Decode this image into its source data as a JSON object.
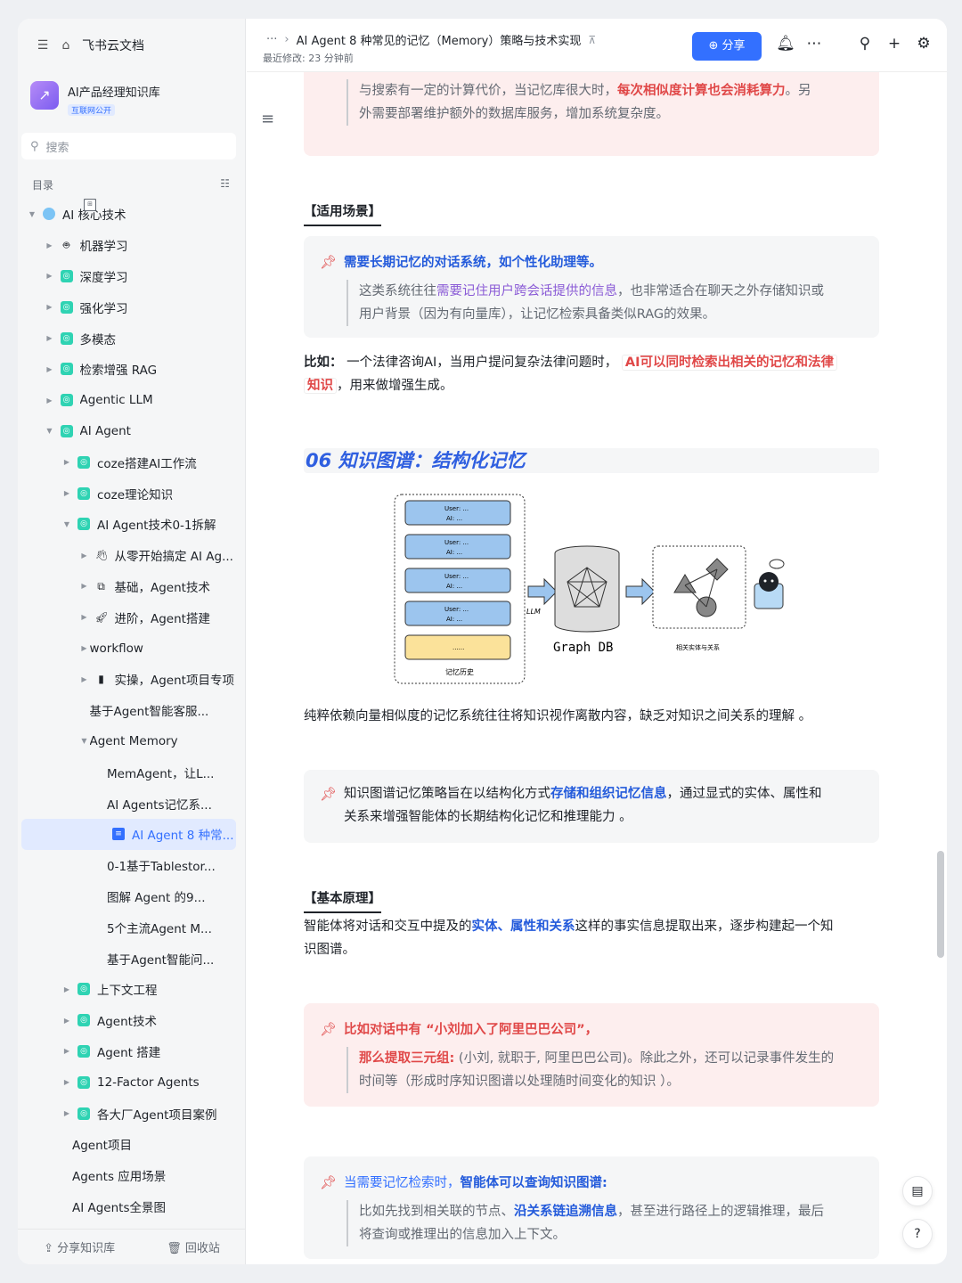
{
  "sidebar": {
    "app_name": "飞书云文档",
    "kb_name": "AI产品经理知识库",
    "kb_tag": "互联网公开",
    "search_placeholder": "搜索",
    "toc_label": "目录",
    "items": [
      {
        "label": "AI 核心技术",
        "level": 0,
        "icon": "globe-icon",
        "arrow": "down"
      },
      {
        "label": "机器学习",
        "level": 1,
        "icon": "robot-emoji-icon",
        "arrow": "right"
      },
      {
        "label": "深度学习",
        "level": 1,
        "icon": "teal-doc-icon",
        "arrow": "right"
      },
      {
        "label": "强化学习",
        "level": 1,
        "icon": "teal-doc-icon",
        "arrow": "right"
      },
      {
        "label": "多模态",
        "level": 1,
        "icon": "teal-doc-icon",
        "arrow": "right"
      },
      {
        "label": "检索增强 RAG",
        "level": 1,
        "icon": "teal-doc-icon",
        "arrow": "right"
      },
      {
        "label": "Agentic LLM",
        "level": 1,
        "icon": "teal-doc-icon",
        "arrow": "right"
      },
      {
        "label": "AI Agent",
        "level": 1,
        "icon": "teal-doc-icon",
        "arrow": "down"
      },
      {
        "label": "coze搭建AI工作流",
        "level": 2,
        "icon": "teal-doc-icon",
        "arrow": "right"
      },
      {
        "label": "coze理论知识",
        "level": 2,
        "icon": "teal-doc-icon",
        "arrow": "right"
      },
      {
        "label": "AI Agent技术0-1拆解",
        "level": 2,
        "icon": "teal-doc-icon",
        "arrow": "down"
      },
      {
        "label": "从零开始搞定 AI Ag...",
        "level": 3,
        "icon": "hand-emoji-icon",
        "arrow": "right"
      },
      {
        "label": "基础，Agent技术",
        "level": 3,
        "icon": "blocks-emoji-icon",
        "arrow": "right"
      },
      {
        "label": "进阶，Agent搭建",
        "level": 3,
        "icon": "rocket-emoji-icon",
        "arrow": "right"
      },
      {
        "label": "workflow",
        "level": 3,
        "icon": "doc-icon",
        "arrow": "right"
      },
      {
        "label": "实操，Agent项目专项",
        "level": 3,
        "icon": "note-emoji-icon",
        "arrow": "right"
      },
      {
        "label": "基于Agent智能客服...",
        "level": 3,
        "icon": "doc-icon",
        "arrow": ""
      },
      {
        "label": "Agent Memory",
        "level": 3,
        "icon": "doc-icon",
        "arrow": "down"
      },
      {
        "label": "MemAgent，让L...",
        "level": 4,
        "icon": "page-icon",
        "arrow": ""
      },
      {
        "label": "AI Agents记忆系...",
        "level": 4,
        "icon": "doc-icon",
        "arrow": ""
      },
      {
        "label": "AI Agent 8 种常...",
        "level": 4,
        "icon": "doc-blue-icon",
        "arrow": "",
        "active": true
      },
      {
        "label": "0-1基于Tablestor...",
        "level": 4,
        "icon": "doc-icon",
        "arrow": ""
      },
      {
        "label": "图解 Agent 的9...",
        "level": 4,
        "icon": "doc-icon",
        "arrow": ""
      },
      {
        "label": "5个主流Agent M...",
        "level": 4,
        "icon": "doc-icon",
        "arrow": ""
      },
      {
        "label": "基于Agent智能问...",
        "level": 4,
        "icon": "doc-icon",
        "arrow": ""
      },
      {
        "label": "上下文工程",
        "level": 2,
        "icon": "teal-doc-icon",
        "arrow": "right"
      },
      {
        "label": "Agent技术",
        "level": 2,
        "icon": "teal-doc-icon",
        "arrow": "right"
      },
      {
        "label": "Agent 搭建",
        "level": 2,
        "icon": "teal-doc-icon",
        "arrow": "right"
      },
      {
        "label": "12-Factor Agents",
        "level": 2,
        "icon": "teal-doc-icon",
        "arrow": "right"
      },
      {
        "label": "各大厂Agent项目案例",
        "level": 2,
        "icon": "teal-doc-icon",
        "arrow": "right"
      },
      {
        "label": "Agent项目",
        "level": 2,
        "icon": "table-icon",
        "arrow": ""
      },
      {
        "label": "Agents 应用场景",
        "level": 2,
        "icon": "table-icon",
        "arrow": ""
      },
      {
        "label": "AI Agents全景图",
        "level": 2,
        "icon": "table-icon",
        "arrow": ""
      }
    ],
    "share_kb": "分享知识库",
    "recycle_bin": "回收站"
  },
  "header": {
    "breadcrumb_more": "···",
    "title": "AI Agent 8 种常见的记忆（Memory）策略与技术实现",
    "last_modified": "最近修改: 23 分钟前",
    "share_label": "分享"
  },
  "doc": {
    "top_callout_line1a": "与搜索有一定的计算代价，当记忆库很大时，",
    "top_callout_line1b": "每次相似度计算也会消耗算力",
    "top_callout_line1c": "。另",
    "top_callout_line2": "外需要部署维护额外的数据库服务，增加系统复杂度。",
    "scene_heading": "【适用场景】",
    "scene_callout_title": "需要长期记忆的对话系统，如个性化助理等。",
    "scene_callout_body_a": "这类系统往往",
    "scene_callout_body_b": "需要记住用户跨会话提供的信息",
    "scene_callout_body_c": "，也非常适合在聊天之外存储知识或",
    "scene_callout_body_d": "用户背景（因为有向量库），让记忆检索具备类似RAG的效果。",
    "example_label": "比如：",
    "example_a": "一个法律咨询AI，当用户提问复杂法律问题时，",
    "example_code1": "AI可以同时检索出相关的记忆和法律",
    "example_code2": "知识",
    "example_b": "，用来做增强生成。",
    "section06": "06 知识图谱：结构化记忆",
    "diagram": {
      "user_line": "User: ...",
      "ai_line": "AI: ...",
      "ellipsis": "......",
      "history_label": "记忆历史",
      "llm_label": "LLM",
      "graphdb_label": "Graph DB",
      "entity_label": "相关实体与关系"
    },
    "para1": "纯粹依赖向量相似度的记忆系统往往将知识视作离散内容，缺乏对知识之间关系的理解 。",
    "kg_callout_a": "知识图谱记忆策略旨在以结构化方式",
    "kg_callout_b": "存储和组织记忆信息",
    "kg_callout_c": "，通过显式的实体、属性和",
    "kg_callout_d": "关系来增强智能体的长期结构化记忆和推理能力 。",
    "basic_heading": "【基本原理】",
    "basic_a": "智能体将对话和交互中提及的",
    "basic_b": "实体、属性和关系",
    "basic_c": "这样的事实信息提取出来，逐步构建起一个知",
    "basic_d": "识图谱。",
    "ex_callout_title": "比如对话中有 “小刘加入了阿里巴巴公司”，",
    "ex_callout_a": "那么提取三元组:",
    "ex_callout_b": " (小刘, 就职于, 阿里巴巴公司)。除此之外，还可以记录事件发生的",
    "ex_callout_c": "时间等（形成时序知识图谱以处理随时间变化的知识 ）。",
    "q_callout_a": "当需要记忆检索时，",
    "q_callout_b": "智能体可以查询知识图谱:",
    "q_callout_c": "比如先找到相关联的节点、",
    "q_callout_d": "沿关系链追溯信息",
    "q_callout_e": "，甚至进行路径上的逻辑推理，最后",
    "q_callout_f": "将查询或推理出的信息加入上下文。"
  }
}
